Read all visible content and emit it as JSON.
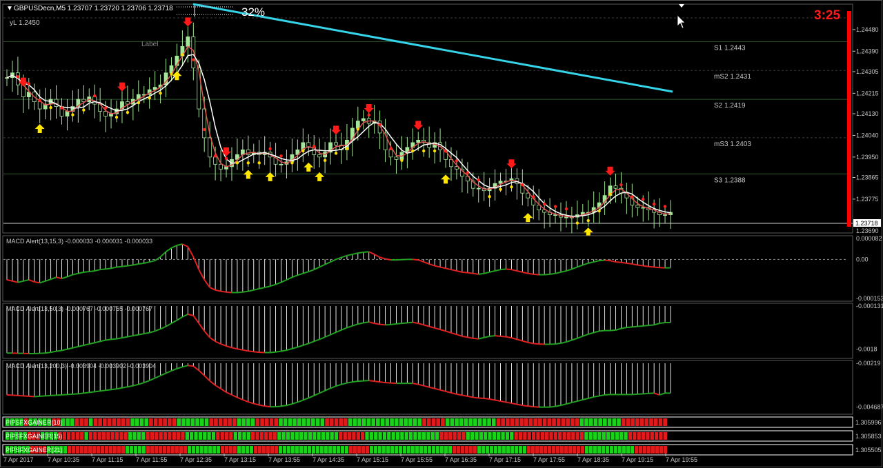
{
  "chart_header": {
    "symbol_line": "GBPUSDecn,M5  1.23707 1.23720 1.23706 1.23718",
    "yl_label": "yL 1.2450",
    "label_text": "Label",
    "percent": "32%",
    "timer": "3:25",
    "current_price": "1.23718",
    "low_price": "1.23690"
  },
  "colors": {
    "background": "#000000",
    "grid": "#2e5a2e",
    "ema_slow": "#35d4e8",
    "fast_ma": "#e05050",
    "candle_bull": "#a6e69a",
    "arrow_down": "#ff1a1a",
    "arrow_up": "#ffe600",
    "dot_red": "#ff2020",
    "dot_yellow": "#ffdd00",
    "macd_up": "#21a021",
    "macd_down": "#e02020",
    "timer": "#ff1a1a",
    "side_bar": "#ff0000"
  },
  "chart_data": [
    {
      "type": "candlestick",
      "title": "GBPUSDecn,M5",
      "ohlc_header": "1.23707 1.23720 1.23706 1.23718",
      "ylim": [
        1.2364,
        1.2458
      ],
      "y_ticks": [
        "1.24480",
        "1.24390",
        "1.24305",
        "1.24215",
        "1.24130",
        "1.24040",
        "1.23950",
        "1.23865",
        "1.23775"
      ],
      "x_ticks": [
        "7 Apr 2017",
        "7 Apr 10:35",
        "7 Apr 11:15",
        "7 Apr 11:55",
        "7 Apr 12:35",
        "7 Apr 13:15",
        "7 Apr 13:55",
        "7 Apr 14:35",
        "7 Apr 15:15",
        "7 Apr 15:55",
        "7 Apr 16:35",
        "7 Apr 17:15",
        "7 Apr 17:55",
        "7 Apr 18:35",
        "7 Apr 19:15",
        "7 Apr 19:55"
      ],
      "levels": [
        {
          "label": "S1 1.2443",
          "value": 1.2443
        },
        {
          "label": "mS2 1.2431",
          "value": 1.2431
        },
        {
          "label": "S2 1.2419",
          "value": 1.2419
        },
        {
          "label": "mS3 1.2403",
          "value": 1.2403
        },
        {
          "label": "S3 1.2388",
          "value": 1.2388
        }
      ],
      "close_series": [
        1.2428,
        1.243,
        1.2425,
        1.242,
        1.2422,
        1.2418,
        1.2415,
        1.2417,
        1.2419,
        1.2416,
        1.2412,
        1.2414,
        1.2416,
        1.2419,
        1.2418,
        1.242,
        1.2417,
        1.2414,
        1.2412,
        1.2413,
        1.2415,
        1.2418,
        1.2417,
        1.2419,
        1.2421,
        1.2421,
        1.2423,
        1.2424,
        1.2425,
        1.243,
        1.2433,
        1.2437,
        1.2441,
        1.2445,
        1.2432,
        1.2415,
        1.2403,
        1.2395,
        1.2392,
        1.239,
        1.2391,
        1.2394,
        1.2396,
        1.2398,
        1.2396,
        1.2397,
        1.2396,
        1.2397,
        1.2395,
        1.2392,
        1.2392,
        1.2393,
        1.2396,
        1.2398,
        1.2401,
        1.2399,
        1.2396,
        1.2395,
        1.2397,
        1.2401,
        1.24,
        1.2398,
        1.2402,
        1.2407,
        1.241,
        1.2411,
        1.2409,
        1.241,
        1.2405,
        1.2398,
        1.2395,
        1.2394,
        1.2397,
        1.2399,
        1.2401,
        1.2402,
        1.2401,
        1.2399,
        1.2401,
        1.2398,
        1.2394,
        1.2391,
        1.239,
        1.2387,
        1.2385,
        1.2382,
        1.2382,
        1.2381,
        1.2382,
        1.2384,
        1.2385,
        1.2385,
        1.2386,
        1.2384,
        1.238,
        1.2378,
        1.2375,
        1.2373,
        1.2372,
        1.2371,
        1.2371,
        1.237,
        1.237,
        1.237,
        1.2371,
        1.2372,
        1.2372,
        1.2374,
        1.2376,
        1.2379,
        1.2383,
        1.2382,
        1.238,
        1.2378,
        1.2375,
        1.2374,
        1.2374,
        1.2373,
        1.2372,
        1.2371,
        1.2371,
        1.2372
      ],
      "ema_slow": {
        "from_value": 1.246,
        "to_value": 1.242,
        "start_bar": 32,
        "end_bar": 118
      }
    },
    {
      "type": "histogram",
      "title": "MACD Alert(13,15,3) -0.000033 -0.000031 -0.000033",
      "y_ticks": [
        "0.000082",
        "0.00",
        "-0.000153"
      ],
      "ylim": [
        -0.000153,
        8.2e-05
      ],
      "values": [
        -8e-05,
        -8.5e-05,
        -9e-05,
        -8.5e-05,
        -8e-05,
        -8.8e-05,
        -9.2e-05,
        -8.5e-05,
        -7.8e-05,
        -7e-05,
        -7.5e-05,
        -6.8e-05,
        -6e-05,
        -5.5e-05,
        -5e-05,
        -4.8e-05,
        -4.5e-05,
        -4e-05,
        -3.8e-05,
        -3.5e-05,
        -3e-05,
        -2.8e-05,
        -2.5e-05,
        -2.2e-05,
        -1.8e-05,
        -1.5e-05,
        -1e-05,
        -5e-06,
        1e-05,
        3e-05,
        4.5e-05,
        5.5e-05,
        6e-05,
        5e-05,
        1e-05,
        -4e-05,
        -8e-05,
        -0.00011,
        -0.00012,
        -0.000125,
        -0.000128,
        -0.00013,
        -0.00013,
        -0.000128,
        -0.000125,
        -0.00012,
        -0.000115,
        -0.00011,
        -0.000105,
        -9.8e-05,
        -9e-05,
        -8e-05,
        -7e-05,
        -6.2e-05,
        -5.5e-05,
        -4.8e-05,
        -4e-05,
        -3e-05,
        -2e-05,
        -1e-05,
        0.0,
        8e-06,
        1.5e-05,
        2e-05,
        2.5e-05,
        2.8e-05,
        3e-05,
        2e-05,
        8e-06,
        2e-06,
        -2e-06,
        -2e-06,
        -1e-06,
        0.0,
        0.0,
        -2e-06,
        -1e-05,
        -1.8e-05,
        -2.5e-05,
        -3e-05,
        -3.5e-05,
        -4e-05,
        -4.5e-05,
        -5e-05,
        -5.2e-05,
        -5.5e-05,
        -5.8e-05,
        -5.5e-05,
        -5e-05,
        -4.5e-05,
        -4e-05,
        -3.8e-05,
        -4e-05,
        -4.5e-05,
        -5e-05,
        -5.5e-05,
        -5.8e-05,
        -6e-05,
        -6e-05,
        -5.8e-05,
        -5.5e-05,
        -5e-05,
        -4.5e-05,
        -3.8e-05,
        -3e-05,
        -2.2e-05,
        -1.5e-05,
        -1e-05,
        -5e-06,
        -3e-06,
        -5e-06,
        -1e-05,
        -1.2e-05,
        -1.5e-05,
        -1.8e-05,
        -2.2e-05,
        -2.5e-05,
        -2.8e-05,
        -3e-05,
        -3.2e-05,
        -3.3e-05,
        -3.3e-05
      ]
    },
    {
      "type": "histogram",
      "title": "MACD Alert(13,50,3) -0.000767 -0.000765 -0.000767",
      "y_ticks": [
        "-0.000131",
        "-0.0018"
      ],
      "ylim": [
        -0.00205,
        -0.000131
      ],
      "values": [
        -0.00195,
        -0.00195,
        -0.00196,
        -0.00196,
        -0.00197,
        -0.00197,
        -0.00196,
        -0.00195,
        -0.00192,
        -0.00188,
        -0.00185,
        -0.0018,
        -0.00175,
        -0.0017,
        -0.00165,
        -0.0016,
        -0.00155,
        -0.0015,
        -0.00145,
        -0.00142,
        -0.0014,
        -0.00136,
        -0.00132,
        -0.00128,
        -0.00124,
        -0.0012,
        -0.00116,
        -0.0011,
        -0.00102,
        -0.00092,
        -0.0008,
        -0.00068,
        -0.00055,
        -0.00045,
        -0.0005,
        -0.0008,
        -0.0011,
        -0.00135,
        -0.0015,
        -0.0016,
        -0.00168,
        -0.00174,
        -0.00179,
        -0.00183,
        -0.00187,
        -0.0019,
        -0.00192,
        -0.00193,
        -0.00193,
        -0.00191,
        -0.00188,
        -0.00184,
        -0.00178,
        -0.00172,
        -0.00165,
        -0.00158,
        -0.0015,
        -0.00142,
        -0.00133,
        -0.00124,
        -0.00115,
        -0.00106,
        -0.00097,
        -0.0009,
        -0.00083,
        -0.00078,
        -0.00075,
        -0.0008,
        -0.00084,
        -0.00086,
        -0.00085,
        -0.00082,
        -0.0008,
        -0.00078,
        -0.00076,
        -0.0008,
        -0.00086,
        -0.00092,
        -0.00098,
        -0.00104,
        -0.0011,
        -0.00117,
        -0.00123,
        -0.0013,
        -0.00134,
        -0.00138,
        -0.0014,
        -0.00135,
        -0.0013,
        -0.00128,
        -0.0013,
        -0.00132,
        -0.00136,
        -0.00142,
        -0.00148,
        -0.00154,
        -0.00158,
        -0.0016,
        -0.00161,
        -0.00161,
        -0.0016,
        -0.00157,
        -0.00152,
        -0.00145,
        -0.00138,
        -0.0013,
        -0.00122,
        -0.00116,
        -0.0011,
        -0.00108,
        -0.00108,
        -0.00106,
        -0.001,
        -0.00096,
        -0.00094,
        -0.00092,
        -0.0009,
        -0.00088,
        -0.00086,
        -0.0008,
        -0.00077,
        -0.00077
      ]
    },
    {
      "type": "histogram",
      "title": "MACD Alert(13,200,3) -0.003904 -0.003902 -0.003904",
      "y_ticks": [
        "-0.00219",
        "-0.004687"
      ],
      "ylim": [
        -0.00495,
        -0.00219
      ],
      "values": [
        -0.004,
        -0.00402,
        -0.00404,
        -0.00406,
        -0.00408,
        -0.0041,
        -0.00408,
        -0.00406,
        -0.00404,
        -0.00402,
        -0.004,
        -0.00398,
        -0.00396,
        -0.00394,
        -0.0039,
        -0.00386,
        -0.00382,
        -0.00378,
        -0.00374,
        -0.0037,
        -0.00366,
        -0.0036,
        -0.00354,
        -0.00348,
        -0.0034,
        -0.0033,
        -0.00318,
        -0.00304,
        -0.0029,
        -0.00276,
        -0.00262,
        -0.0025,
        -0.0024,
        -0.00232,
        -0.00236,
        -0.0026,
        -0.0029,
        -0.0032,
        -0.00345,
        -0.00365,
        -0.00385,
        -0.004,
        -0.00415,
        -0.00428,
        -0.0044,
        -0.0045,
        -0.00458,
        -0.00464,
        -0.00468,
        -0.00468,
        -0.00465,
        -0.0046,
        -0.00452,
        -0.00442,
        -0.0043,
        -0.00418,
        -0.00404,
        -0.0039,
        -0.00376,
        -0.00362,
        -0.0035,
        -0.0034,
        -0.00332,
        -0.00326,
        -0.00322,
        -0.0032,
        -0.00318,
        -0.00322,
        -0.00326,
        -0.0033,
        -0.00332,
        -0.00334,
        -0.00334,
        -0.00334,
        -0.00334,
        -0.0034,
        -0.00348,
        -0.00356,
        -0.00364,
        -0.00372,
        -0.0038,
        -0.00388,
        -0.00396,
        -0.00402,
        -0.00408,
        -0.00414,
        -0.00418,
        -0.0042,
        -0.00424,
        -0.0043,
        -0.00436,
        -0.00442,
        -0.00448,
        -0.00454,
        -0.0046,
        -0.00464,
        -0.00468,
        -0.0047,
        -0.0047,
        -0.0047,
        -0.00466,
        -0.0046,
        -0.00452,
        -0.00444,
        -0.00436,
        -0.00428,
        -0.0042,
        -0.00412,
        -0.00406,
        -0.004,
        -0.00398,
        -0.00398,
        -0.00398,
        -0.00398,
        -0.00398,
        -0.00396,
        -0.00394,
        -0.00392,
        -0.0039,
        -0.004,
        -0.0039,
        -0.0039
      ]
    },
    {
      "type": "heatmap",
      "title": "PIPSFXGAINER",
      "rows": [
        {
          "name": "PIPSFXGAINER(10)",
          "value": "1.305996",
          "states": "GGGGRGGGGGRRGGGRRRGRRRRRRRRGGGGRRRRRRGGGGGGGRRRRRRGGGGRRRRRGGGGGGGGGGRRRRRGGGGGGGGGGGGGGGGRRRRRGGGGGGGGGGGRRRRRRRRRRRRRRRRRRGGGGGGGGGRRRRRRRRRR"
        },
        {
          "name": "PIPSFXGAINER(15)",
          "value": "1.305853",
          "states": "GGGGGRRRGGGGRRRRRRGRRRRRRRRRGGGGRRRRRRRRRGGGGGGGRRRRGGGGRRRRRRGGGGGGGGGGGGGGRRRRRRGGGGGGGGGGGGGGGGGRRRRRRGGGGGGGGGGGRRRRRRRRRRRRRRRRGGGGGGGGGGRRRRRRRRR"
        },
        {
          "name": "PIPSFXGAINER(21)",
          "value": "1.305505",
          "states": "GGGGGGRRRRGGGGGRRRRRRRRRRRRRRGGGGGRRRRRRRRRRGGGGGGGGRRRRGGGGRRRRRRGGGGGGGGGGGGGGGGGRRRRRGGGGGGGGGGGGGGGGGGGGRRRRRRGGGGGGGGGGGGRRRRRRRRRRRRRRGGGGGGGGGGGGRRRRRRRRR"
        }
      ]
    }
  ]
}
